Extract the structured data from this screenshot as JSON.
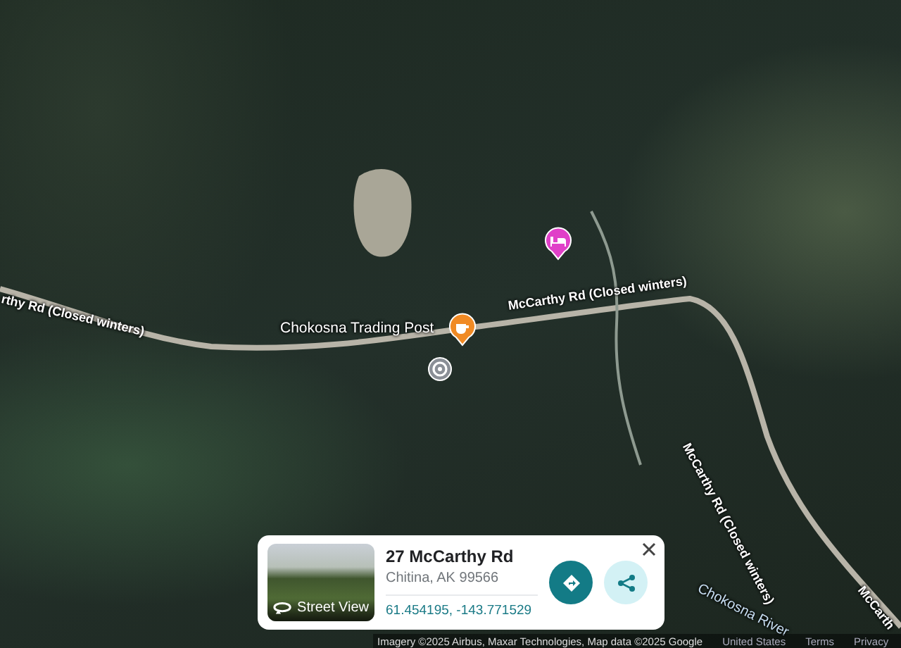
{
  "map": {
    "labels": [
      {
        "text": "rthy Rd (Closed winters)",
        "kind": "road"
      },
      {
        "text": "McCarthy Rd (Closed winters)",
        "kind": "road"
      },
      {
        "text": "McCarthy Rd (Closed winters)",
        "kind": "road"
      },
      {
        "text": "McCarth",
        "kind": "road"
      },
      {
        "text": "Chokosna River",
        "kind": "water"
      },
      {
        "text": "Chokosna Trading Post",
        "kind": "place"
      }
    ],
    "pins": [
      {
        "kind": "cafe",
        "color": "#f08a24"
      },
      {
        "kind": "lodging",
        "color": "#e040c8"
      },
      {
        "kind": "location",
        "color": "#8a8f96"
      }
    ]
  },
  "place_card": {
    "street_view_label": "Street View",
    "title": "27 McCarthy Rd",
    "address": "Chitina, AK 99566",
    "coordinates": "61.454195, -143.771529"
  },
  "footer": {
    "attribution": "Imagery ©2025 Airbus, Maxar Technologies, Map data ©2025 Google",
    "links": [
      "United States",
      "Terms",
      "Privacy"
    ]
  }
}
